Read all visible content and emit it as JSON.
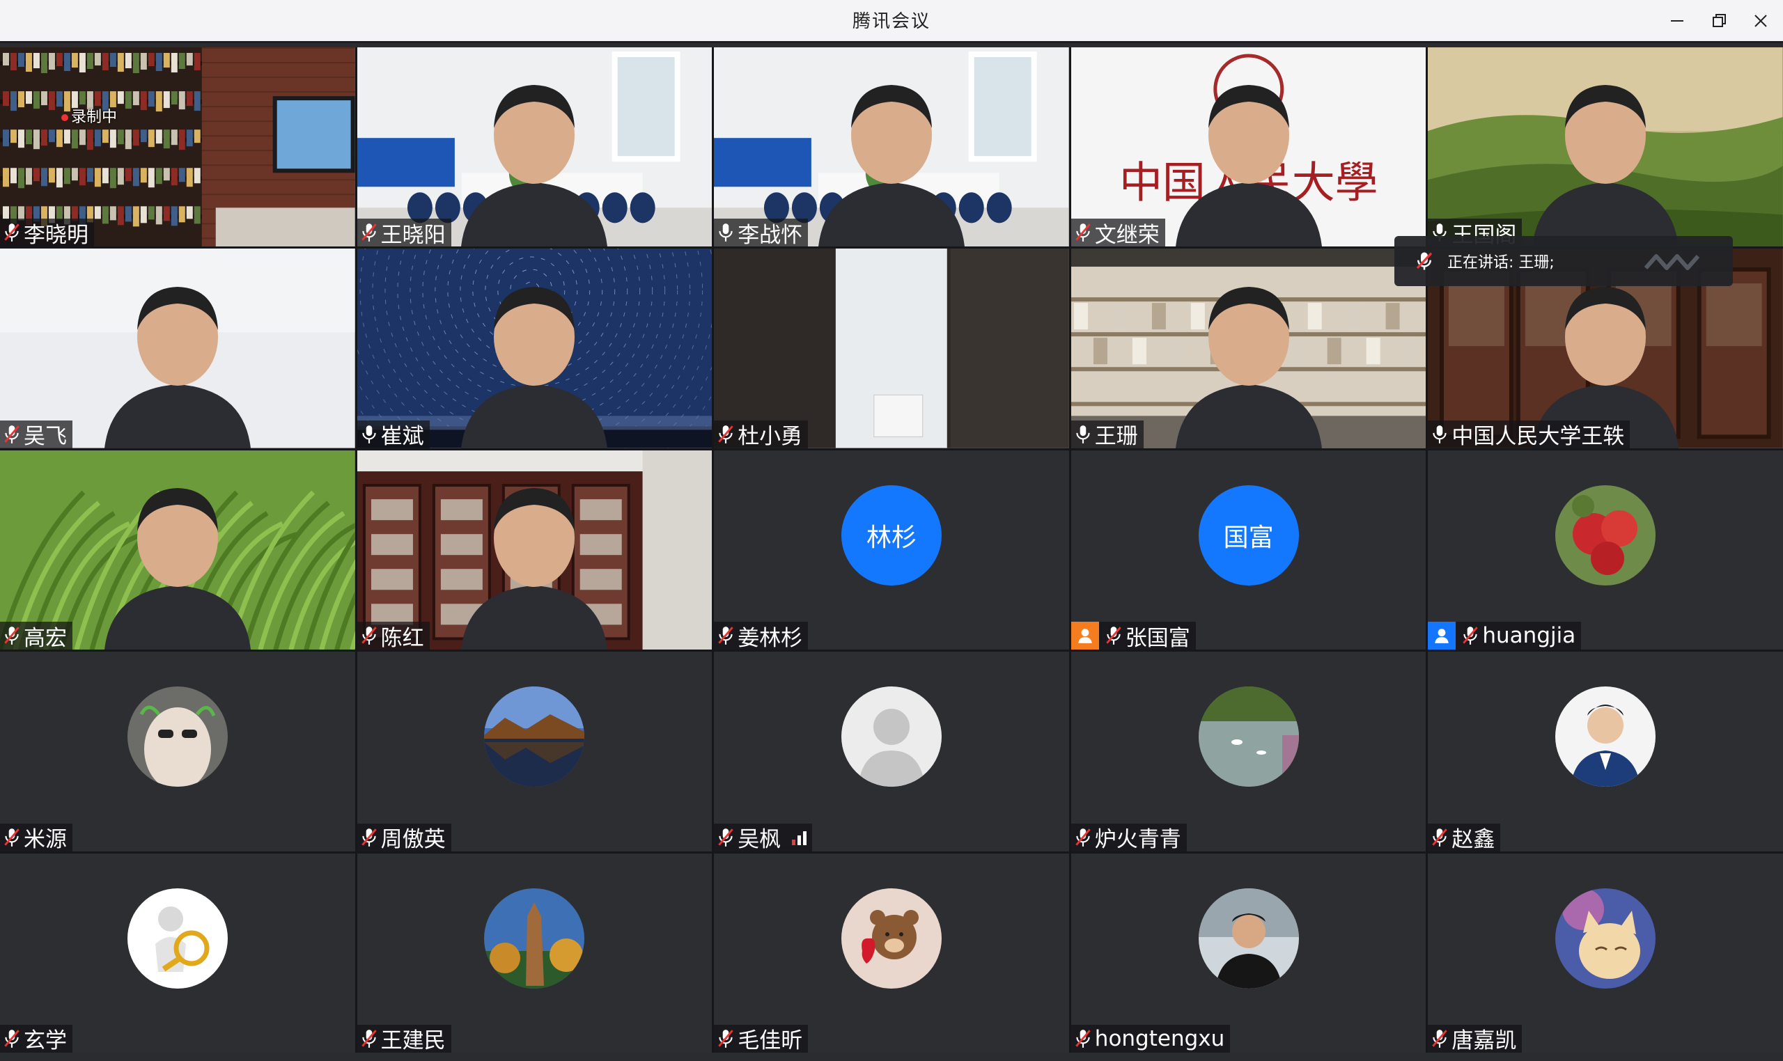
{
  "window": {
    "title": "腾讯会议"
  },
  "recording_label": "录制中",
  "speaking": {
    "label": "正在讲话: 王珊;"
  },
  "tiles": [
    {
      "name": "李晓明",
      "type": "video",
      "scene": "bookshelf",
      "mic": "muted"
    },
    {
      "name": "王晓阳",
      "type": "video",
      "scene": "office",
      "mic": "muted"
    },
    {
      "name": "李战怀",
      "type": "video",
      "scene": "office",
      "mic": "on"
    },
    {
      "name": "文继荣",
      "type": "video",
      "scene": "university",
      "mic": "muted"
    },
    {
      "name": "王国阁",
      "type": "video",
      "scene": "landscape",
      "mic": "on"
    },
    {
      "name": "吴飞",
      "type": "video",
      "scene": "white",
      "mic": "muted"
    },
    {
      "name": "崔斌",
      "type": "video",
      "scene": "startrail",
      "mic": "on"
    },
    {
      "name": "杜小勇",
      "type": "video",
      "scene": "room",
      "mic": "muted"
    },
    {
      "name": "王珊",
      "type": "video",
      "scene": "study",
      "mic": "on"
    },
    {
      "name": "中国人民大学王轶",
      "type": "video",
      "scene": "cabinet",
      "mic": "on"
    },
    {
      "name": "高宏",
      "type": "video",
      "scene": "grass",
      "mic": "muted"
    },
    {
      "name": "陈红",
      "type": "video",
      "scene": "library",
      "mic": "muted"
    },
    {
      "name": "姜林杉",
      "type": "avatar-text",
      "avatar_text": "林杉",
      "mic": "muted"
    },
    {
      "name": "张国富",
      "type": "avatar-text",
      "avatar_text": "国富",
      "mic": "muted",
      "badge": "orange"
    },
    {
      "name": "huangjia",
      "type": "avatar",
      "avatar": "apple",
      "mic": "muted",
      "badge": "blue"
    },
    {
      "name": "米源",
      "type": "avatar",
      "avatar": "ghost",
      "mic": "muted"
    },
    {
      "name": "周傲英",
      "type": "avatar",
      "avatar": "lake",
      "mic": "muted"
    },
    {
      "name": "吴枫",
      "type": "avatar",
      "avatar": "default",
      "mic": "muted",
      "signal": true
    },
    {
      "name": "炉火青青",
      "type": "avatar",
      "avatar": "pond",
      "mic": "muted"
    },
    {
      "name": "赵鑫",
      "type": "avatar",
      "avatar": "portrait",
      "mic": "muted"
    },
    {
      "name": "玄学",
      "type": "avatar",
      "avatar": "magnifier",
      "mic": "muted"
    },
    {
      "name": "王建民",
      "type": "avatar",
      "avatar": "tree",
      "mic": "muted"
    },
    {
      "name": "毛佳昕",
      "type": "avatar",
      "avatar": "bear",
      "mic": "muted"
    },
    {
      "name": "hongtengxu",
      "type": "avatar",
      "avatar": "snow",
      "mic": "muted"
    },
    {
      "name": "唐嘉凯",
      "type": "avatar",
      "avatar": "cat",
      "mic": "muted"
    }
  ],
  "colors": {
    "titlebar": "#f4f4f6",
    "tile_bg": "#2c2e32",
    "avatar_blue": "#1478ff",
    "badge_orange": "#f57c1f",
    "badge_blue": "#1476ff"
  }
}
